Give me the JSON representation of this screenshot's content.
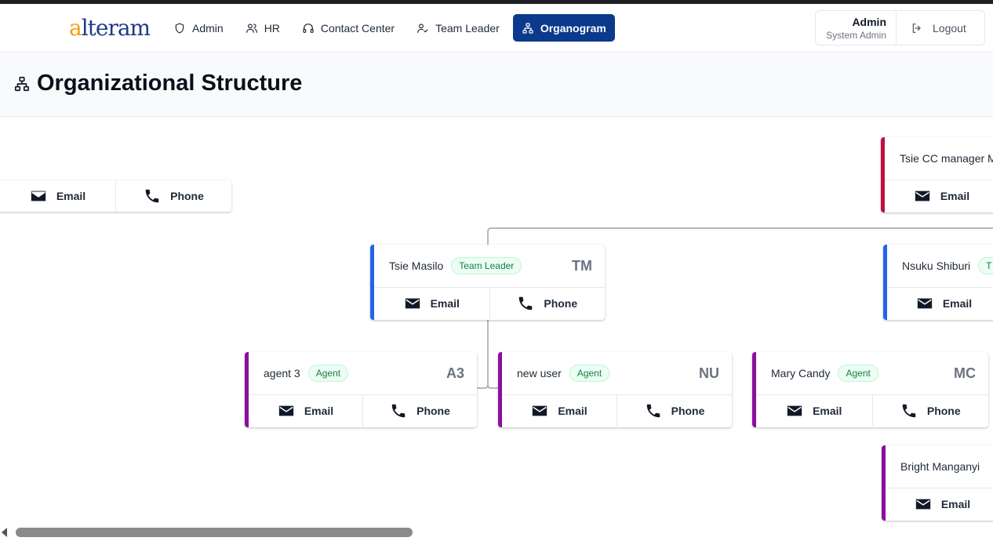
{
  "logo": {
    "text_a": "a",
    "text_rest": "lteram"
  },
  "nav": {
    "items": [
      {
        "label": "Admin",
        "icon": "shield-icon",
        "active": false
      },
      {
        "label": "HR",
        "icon": "users-icon",
        "active": false
      },
      {
        "label": "Contact Center",
        "icon": "headset-icon",
        "active": false
      },
      {
        "label": "Team Leader",
        "icon": "user-check-icon",
        "active": false
      },
      {
        "label": "Organogram",
        "icon": "org-chart-icon",
        "active": true
      }
    ]
  },
  "user": {
    "name": "Admin",
    "role": "System Admin",
    "logout_label": "Logout"
  },
  "page": {
    "title": "Organizational Structure"
  },
  "actions": {
    "email": "Email",
    "phone": "Phone"
  },
  "cards": [
    {
      "id": "left-partial",
      "name": "",
      "badge": "",
      "initials": "",
      "color": "#be123c"
    },
    {
      "id": "tsie-cc-manager",
      "name": "Tsie CC manager M",
      "badge": "",
      "initials": "",
      "color": "#be123c"
    },
    {
      "id": "tsie-masilo",
      "name": "Tsie Masilo",
      "badge": "Team Leader",
      "initials": "TM",
      "color": "#2563eb"
    },
    {
      "id": "nsuku-shiburi",
      "name": "Nsuku Shiburi",
      "badge": "T",
      "initials": "",
      "color": "#2563eb"
    },
    {
      "id": "agent-3",
      "name": "agent 3",
      "badge": "Agent",
      "initials": "A3",
      "color": "#8b0f9e"
    },
    {
      "id": "new-user",
      "name": "new user",
      "badge": "Agent",
      "initials": "NU",
      "color": "#8b0f9e"
    },
    {
      "id": "mary-candy",
      "name": "Mary Candy",
      "badge": "Agent",
      "initials": "MC",
      "color": "#8b0f9e"
    },
    {
      "id": "bright-manganyi",
      "name": "Bright Manganyi",
      "badge": "",
      "initials": "",
      "color": "#8b0f9e"
    }
  ]
}
